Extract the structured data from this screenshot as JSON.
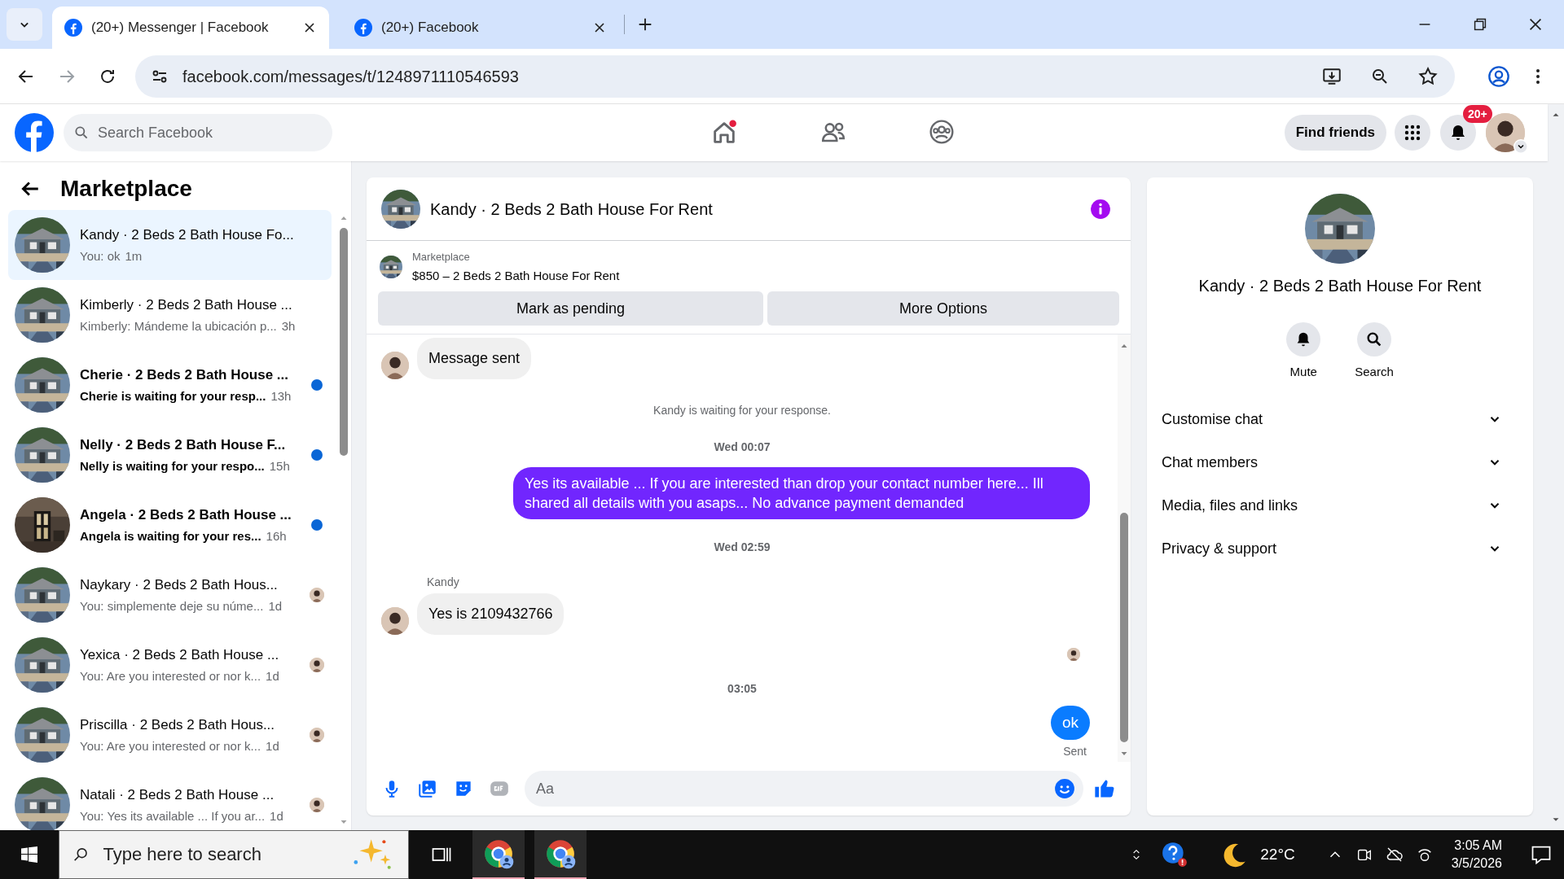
{
  "browser": {
    "tabs": [
      {
        "title": "(20+) Messenger | Facebook",
        "selected": true
      },
      {
        "title": "(20+) Facebook",
        "selected": false
      }
    ],
    "url": "facebook.com/messages/t/1248971110546593"
  },
  "header": {
    "search": {
      "placeholder": "Search Facebook"
    },
    "find_friends": "Find friends",
    "notification_badge": "20+"
  },
  "sidebar": {
    "title": "Marketplace",
    "conversations": [
      {
        "name": "Kandy · 2 Beds 2 Bath House Fo...",
        "preview": "You: ok",
        "time": "1m",
        "selected": true,
        "unread": false,
        "seen": false,
        "kind": "house"
      },
      {
        "name": "Kimberly · 2 Beds 2 Bath House ...",
        "preview": "Kimberly: Mándeme la ubicación p...",
        "time": "3h",
        "selected": false,
        "unread": false,
        "seen": false,
        "kind": "house"
      },
      {
        "name": "Cherie · 2 Beds 2 Bath House ...",
        "preview": "Cherie is waiting for your resp...",
        "time": "13h",
        "selected": false,
        "unread": true,
        "seen": false,
        "kind": "house"
      },
      {
        "name": "Nelly · 2 Beds 2 Bath House F...",
        "preview": "Nelly is waiting for your respo...",
        "time": "15h",
        "selected": false,
        "unread": true,
        "seen": false,
        "kind": "house"
      },
      {
        "name": "Angela · 2 Beds 2 Bath House ...",
        "preview": "Angela is waiting for your res...",
        "time": "16h",
        "selected": false,
        "unread": true,
        "seen": false,
        "kind": "door"
      },
      {
        "name": "Naykary · 2 Beds 2 Bath Hous...",
        "preview": "You: simplemente deje su núme...",
        "time": "1d",
        "selected": false,
        "unread": false,
        "seen": true,
        "kind": "house"
      },
      {
        "name": "Yexica · 2 Beds 2 Bath House ...",
        "preview": "You: Are you interested or nor k...",
        "time": "1d",
        "selected": false,
        "unread": false,
        "seen": true,
        "kind": "house"
      },
      {
        "name": "Priscilla · 2 Beds 2 Bath Hous...",
        "preview": "You: Are you interested or nor k...",
        "time": "1d",
        "selected": false,
        "unread": false,
        "seen": true,
        "kind": "house"
      },
      {
        "name": "Natali · 2 Beds 2 Bath House ...",
        "preview": "You: Yes its available ... If you ar...",
        "time": "1d",
        "selected": false,
        "unread": false,
        "seen": true,
        "kind": "house"
      }
    ]
  },
  "chat": {
    "title": "Kandy · 2 Beds 2 Bath House For Rent",
    "listing": {
      "label": "Marketplace",
      "text": "$850 – 2 Beds 2 Bath House For Rent"
    },
    "buttons": [
      "Mark as pending",
      "More Options"
    ],
    "messages": [
      {
        "kind": "incoming",
        "text": "Message sent"
      },
      {
        "kind": "notice",
        "text": "Kandy is waiting for your response."
      },
      {
        "kind": "time",
        "text": "Wed 00:07"
      },
      {
        "kind": "outgoing",
        "text": "Yes its available ... If you are interested  than drop your contact number here... Ill shared all details with you asaps... No advance payment demanded"
      },
      {
        "kind": "time",
        "text": "Wed 02:59"
      },
      {
        "kind": "sender",
        "text": "Kandy"
      },
      {
        "kind": "incoming",
        "text": "Yes is 2109432766"
      },
      {
        "kind": "receipt"
      },
      {
        "kind": "time",
        "text": "03:05"
      },
      {
        "kind": "sent",
        "text": "ok"
      },
      {
        "kind": "status",
        "text": "Sent"
      }
    ],
    "composer": {
      "placeholder": "Aa"
    }
  },
  "details": {
    "title": "Kandy · 2 Beds 2 Bath House For Rent",
    "actions": [
      {
        "label": "Mute",
        "kind": "bell"
      },
      {
        "label": "Search",
        "kind": "search"
      }
    ],
    "sections": [
      "Customise chat",
      "Chat members",
      "Media, files and links",
      "Privacy & support"
    ]
  },
  "taskbar": {
    "search": {
      "placeholder": "Type here to search"
    },
    "temperature": "22°C",
    "time": "3:05 AM",
    "date": "3/5/2026"
  }
}
